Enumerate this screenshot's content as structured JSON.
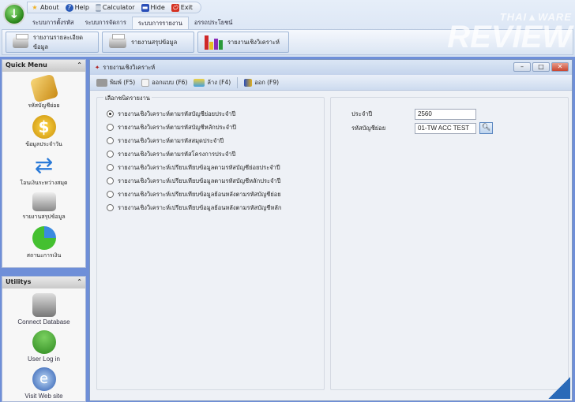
{
  "quick_access": {
    "about": "About",
    "help": "Help",
    "calculator": "Calculator",
    "hide": "Hide",
    "exit": "Exit"
  },
  "ribbon_tabs": [
    "ระบบการตั้งรหัส",
    "ระบบการจัดการ",
    "ระบบการรายงาน",
    "อรรถประโยชน์"
  ],
  "ribbon_buttons": [
    "รายงานรายละเอียดข้อมูล",
    "รายงานสรุปข้อมูล",
    "รายงานเชิงวิเคราะห์"
  ],
  "sidebar": {
    "quick_menu": {
      "title": "Quick Menu",
      "items": [
        "รหัสบัญชีย่อย",
        "ข้อมูลประจำวัน",
        "โอนเงินระหว่างสมุด",
        "รายงานสรุปข้อมูล",
        "สถานะการเงิน"
      ]
    },
    "utilitys": {
      "title": "Utilitys",
      "items": [
        "Connect Database",
        "User Log in",
        "Visit Web site"
      ]
    }
  },
  "window": {
    "title": "รายงานเชิงวิเคราะห์",
    "toolbar": {
      "print": "พิมพ์ (F5)",
      "design": "ออกแบบ (F6)",
      "clear": "ล้าง (F4)",
      "exit": "ออก (F9)"
    },
    "report_group": {
      "title": "เลือกชนิดรายงาน",
      "selected": 0,
      "options": [
        "รายงานเชิงวิเคราะห์ตามรหัสบัญชีย่อยประจำปี",
        "รายงานเชิงวิเคราะห์ตามรหัสบัญชีหลักประจำปี",
        "รายงานเชิงวิเคราะห์ตามรหัสสมุดประจำปี",
        "รายงานเชิงวิเคราะห์ตามรหัสโครงการประจำปี",
        "รายงานเชิงวิเคราะห์เปรียบเทียบข้อมูลตามรหัสบัญชีย่อยประจำปี",
        "รายงานเชิงวิเคราะห์เปรียบเทียบข้อมูลตามรหัสบัญชีหลักประจำปี",
        "รายงานเชิงวิเคราะห์เปรียบเทียบข้อมูลย้อนหลังตามรหัสบัญชีย่อย",
        "รายงานเชิงวิเคราะห์เปรียบเทียบข้อมูลย้อนหลังตามรหัสบัญชีหลัก"
      ]
    },
    "fields": {
      "year_label": "ประจำปี",
      "year_value": "2560",
      "account_label": "รหัสบัญชีย่อย",
      "account_value": "01-TW ACC TEST"
    }
  },
  "watermark": "THAIWARE REVIEW"
}
